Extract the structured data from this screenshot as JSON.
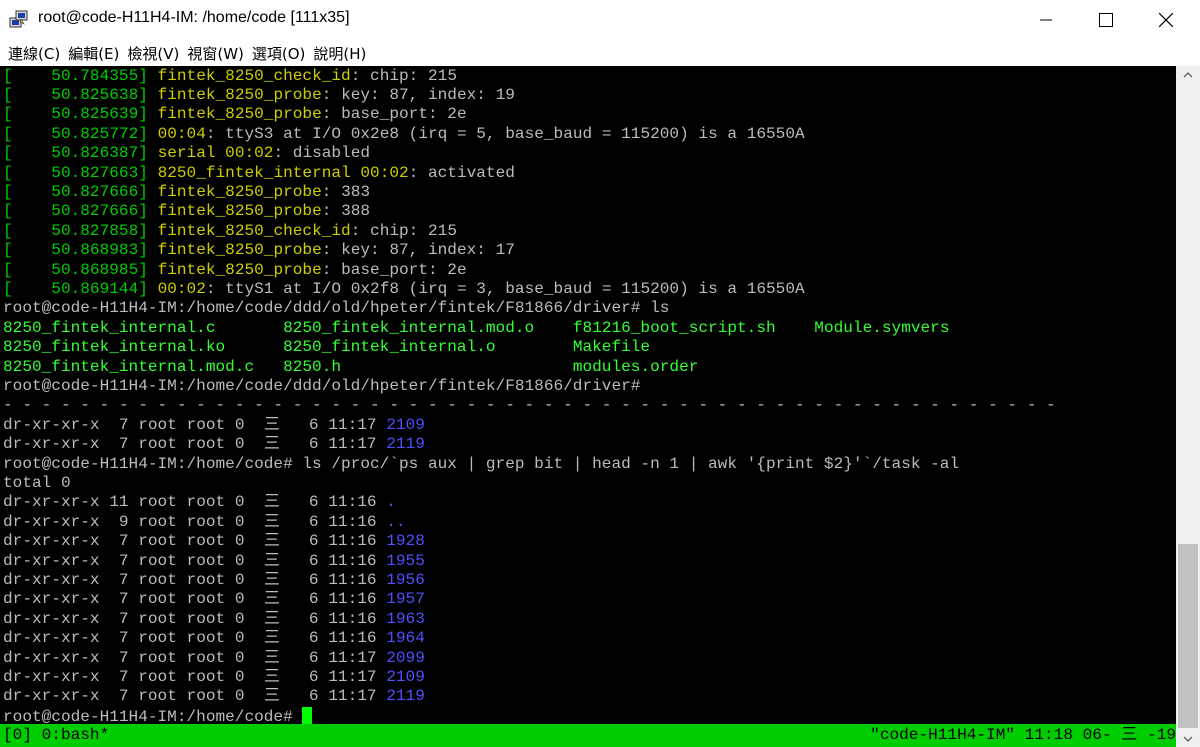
{
  "window": {
    "title": "root@code-H11H4-IM: /home/code [111x35]",
    "icon": "putty-icon"
  },
  "menu": [
    "連線(C)",
    "編輯(E)",
    "檢視(V)",
    "視窗(W)",
    "選項(O)",
    "說明(H)"
  ],
  "colors": {
    "terminal_bg": "#000000",
    "kernel_time": "#00cd00",
    "kernel_func": "#cdcd00",
    "dir_blue": "#4f4fff",
    "status_bar": "#00cd00"
  },
  "terminal": {
    "kernel_log": [
      {
        "ts": "50.784355",
        "fn": "fintek_8250_check_id",
        "msg": ": chip: 215"
      },
      {
        "ts": "50.825638",
        "fn": "fintek_8250_probe",
        "msg": ": key: 87, index: 19"
      },
      {
        "ts": "50.825639",
        "fn": "fintek_8250_probe",
        "msg": ": base_port: 2e"
      },
      {
        "ts": "50.825772",
        "fn": "00:04",
        "msg": ": ttyS3 at I/O 0x2e8 (irq = 5, base_baud = 115200) is a 16550A"
      },
      {
        "ts": "50.826387",
        "fn": "serial 00:02",
        "msg": ": disabled"
      },
      {
        "ts": "50.827663",
        "fn": "8250_fintek_internal 00:02",
        "msg": ": activated"
      },
      {
        "ts": "50.827666",
        "fn": "fintek_8250_probe",
        "msg": ": 383"
      },
      {
        "ts": "50.827666",
        "fn": "fintek_8250_probe",
        "msg": ": 388"
      },
      {
        "ts": "50.827858",
        "fn": "fintek_8250_check_id",
        "msg": ": chip: 215"
      },
      {
        "ts": "50.868983",
        "fn": "fintek_8250_probe",
        "msg": ": key: 87, index: 17"
      },
      {
        "ts": "50.868985",
        "fn": "fintek_8250_probe",
        "msg": ": base_port: 2e"
      },
      {
        "ts": "50.869144",
        "fn": "00:02",
        "msg": ": ttyS1 at I/O 0x2f8 (irq = 3, base_baud = 115200) is a 16550A"
      }
    ],
    "prompt_ls": "root@code-H11H4-IM:/home/code/ddd/old/hpeter/fintek/F81866/driver# ls",
    "ls_rows": [
      [
        "8250_fintek_internal.c",
        "8250_fintek_internal.mod.o",
        "f81216_boot_script.sh",
        "Module.symvers"
      ],
      [
        "8250_fintek_internal.ko",
        "8250_fintek_internal.o",
        "Makefile",
        ""
      ],
      [
        "8250_fintek_internal.mod.c",
        "8250.h",
        "modules.order",
        ""
      ]
    ],
    "prompt_driver": "root@code-H11H4-IM:/home/code/ddd/old/hpeter/fintek/F81866/driver#",
    "dashes": "- - - - - - - - - - - - - - - - - - - - - - - - - - - - - - - - - - - - - - - - - - - - - - - - - - - - - - -",
    "listing_before": [
      {
        "perm": "dr-xr-xr-x",
        "links": " 7",
        "owner": "root",
        "group": "root",
        "size": "0",
        "mon": "三",
        "day": " 6",
        "time": "11:17",
        "name": "2109"
      },
      {
        "perm": "dr-xr-xr-x",
        "links": " 7",
        "owner": "root",
        "group": "root",
        "size": "0",
        "mon": "三",
        "day": " 6",
        "time": "11:17",
        "name": "2119"
      }
    ],
    "prompt_cmd": "root@code-H11H4-IM:/home/code# ls /proc/`ps aux | grep bit | head -n 1 | awk '{print $2}'`/task -al",
    "total": "total 0",
    "listing": [
      {
        "perm": "dr-xr-xr-x",
        "links": "11",
        "owner": "root",
        "group": "root",
        "size": "0",
        "mon": "三",
        "day": " 6",
        "time": "11:16",
        "name": "."
      },
      {
        "perm": "dr-xr-xr-x",
        "links": " 9",
        "owner": "root",
        "group": "root",
        "size": "0",
        "mon": "三",
        "day": " 6",
        "time": "11:16",
        "name": ".."
      },
      {
        "perm": "dr-xr-xr-x",
        "links": " 7",
        "owner": "root",
        "group": "root",
        "size": "0",
        "mon": "三",
        "day": " 6",
        "time": "11:16",
        "name": "1928"
      },
      {
        "perm": "dr-xr-xr-x",
        "links": " 7",
        "owner": "root",
        "group": "root",
        "size": "0",
        "mon": "三",
        "day": " 6",
        "time": "11:16",
        "name": "1955"
      },
      {
        "perm": "dr-xr-xr-x",
        "links": " 7",
        "owner": "root",
        "group": "root",
        "size": "0",
        "mon": "三",
        "day": " 6",
        "time": "11:16",
        "name": "1956"
      },
      {
        "perm": "dr-xr-xr-x",
        "links": " 7",
        "owner": "root",
        "group": "root",
        "size": "0",
        "mon": "三",
        "day": " 6",
        "time": "11:16",
        "name": "1957"
      },
      {
        "perm": "dr-xr-xr-x",
        "links": " 7",
        "owner": "root",
        "group": "root",
        "size": "0",
        "mon": "三",
        "day": " 6",
        "time": "11:16",
        "name": "1963"
      },
      {
        "perm": "dr-xr-xr-x",
        "links": " 7",
        "owner": "root",
        "group": "root",
        "size": "0",
        "mon": "三",
        "day": " 6",
        "time": "11:16",
        "name": "1964"
      },
      {
        "perm": "dr-xr-xr-x",
        "links": " 7",
        "owner": "root",
        "group": "root",
        "size": "0",
        "mon": "三",
        "day": " 6",
        "time": "11:17",
        "name": "2099"
      },
      {
        "perm": "dr-xr-xr-x",
        "links": " 7",
        "owner": "root",
        "group": "root",
        "size": "0",
        "mon": "三",
        "day": " 6",
        "time": "11:17",
        "name": "2109"
      },
      {
        "perm": "dr-xr-xr-x",
        "links": " 7",
        "owner": "root",
        "group": "root",
        "size": "0",
        "mon": "三",
        "day": " 6",
        "time": "11:17",
        "name": "2119"
      }
    ],
    "prompt_final": "root@code-H11H4-IM:/home/code# "
  },
  "status": {
    "left": "[0] 0:bash*",
    "right": "\"code-H11H4-IM\" 11:18 06- 三 -19"
  }
}
